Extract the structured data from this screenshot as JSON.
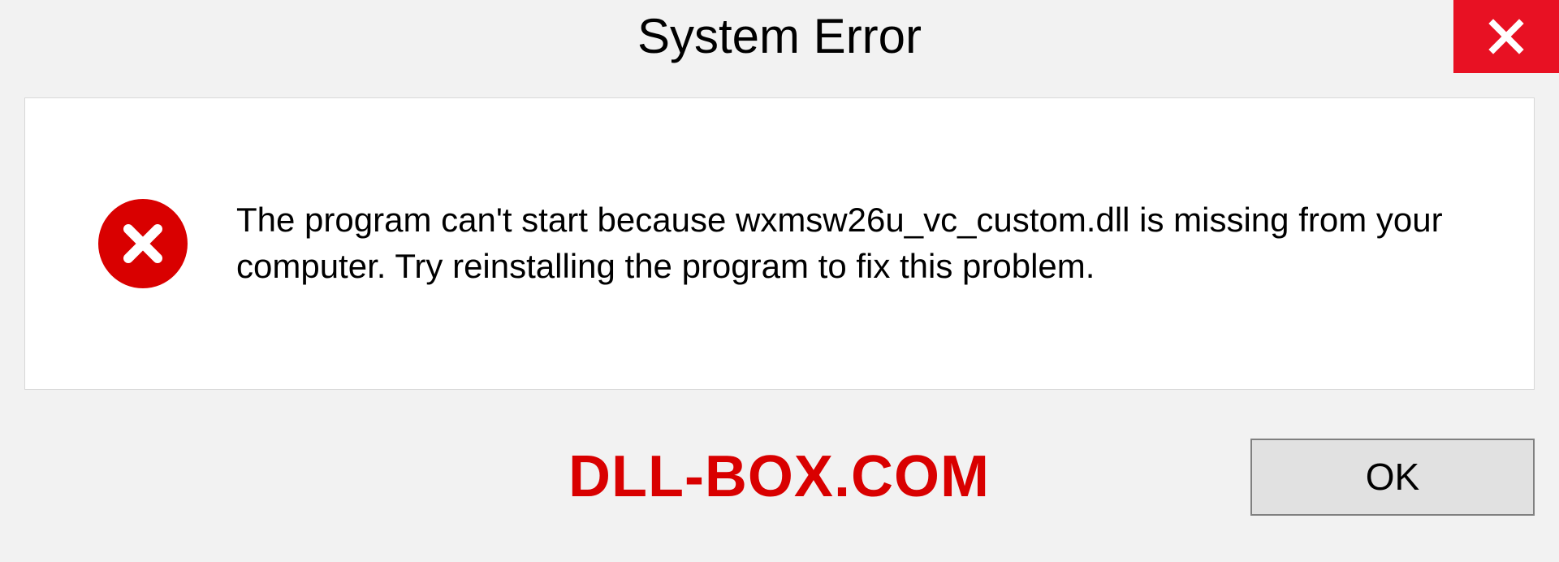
{
  "title": "System Error",
  "message": "The program can't start because wxmsw26u_vc_custom.dll is missing from your computer. Try reinstalling the program to fix this problem.",
  "watermark": "DLL-BOX.COM",
  "buttons": {
    "ok": "OK"
  }
}
